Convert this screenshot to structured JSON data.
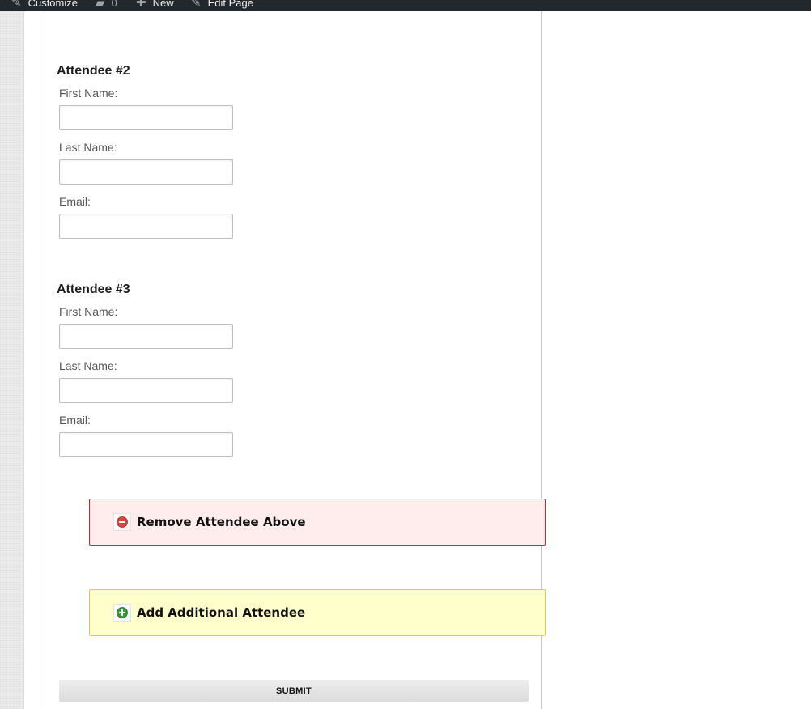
{
  "admin_bar": {
    "items": [
      {
        "icon": "brush-icon",
        "label": "Customize"
      },
      {
        "icon": "comment-icon",
        "label": "0"
      },
      {
        "icon": "plus-icon",
        "label": "New"
      },
      {
        "icon": "pencil-icon",
        "label": "Edit Page"
      }
    ]
  },
  "attendees": [
    {
      "heading": "Attendee #2",
      "first_name_label": "First Name:",
      "first_name_value": "",
      "last_name_label": "Last Name:",
      "last_name_value": "",
      "email_label": "Email:",
      "email_value": ""
    },
    {
      "heading": "Attendee #3",
      "first_name_label": "First Name:",
      "first_name_value": "",
      "last_name_label": "Last Name:",
      "last_name_value": "",
      "email_label": "Email:",
      "email_value": ""
    }
  ],
  "actions": {
    "remove_label": "Remove Attendee Above",
    "add_label": "Add Additional Attendee"
  },
  "submit_label": "SUBMIT",
  "colors": {
    "admin_bar_bg": "#23282d",
    "remove_border": "#d0272a",
    "remove_bg": "#ffeded",
    "add_border": "#e8c84a",
    "add_bg": "#ffffcc",
    "remove_icon": "#d94444",
    "add_icon": "#3a9b3a"
  }
}
